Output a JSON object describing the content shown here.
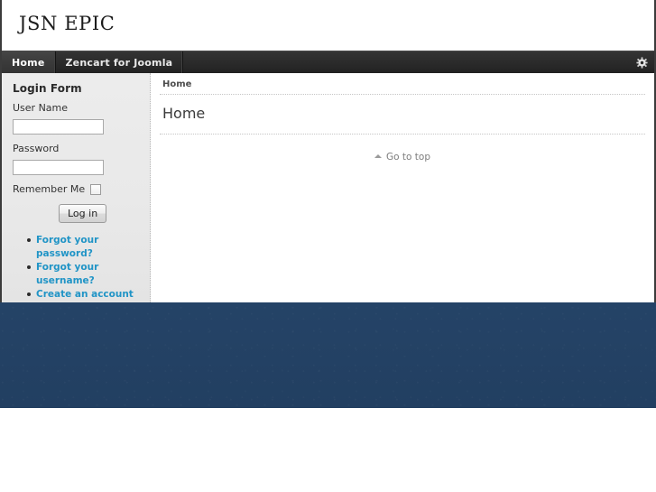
{
  "site": {
    "logo_text": "JSN EPIC",
    "background_color": "#2a4c73",
    "accent_link_color": "#2094c6",
    "navbar_color": "#2c2c2c"
  },
  "navbar": {
    "items": [
      {
        "label": "Home",
        "active": true
      },
      {
        "label": "Zencart for Joomla",
        "active": false
      }
    ],
    "settings_icon": "gear-icon"
  },
  "sidebar": {
    "login_module": {
      "title": "Login Form",
      "username_label": "User Name",
      "username_value": "",
      "username_placeholder": "",
      "password_label": "Password",
      "password_value": "",
      "password_placeholder": "",
      "remember_label": "Remember Me",
      "remember_checked": false,
      "submit_label": "Log in",
      "links": [
        "Forgot your password?",
        "Forgot your username?",
        "Create an account"
      ]
    }
  },
  "main": {
    "breadcrumb": "Home",
    "page_title": "Home",
    "go_to_top_label": "Go to top"
  }
}
